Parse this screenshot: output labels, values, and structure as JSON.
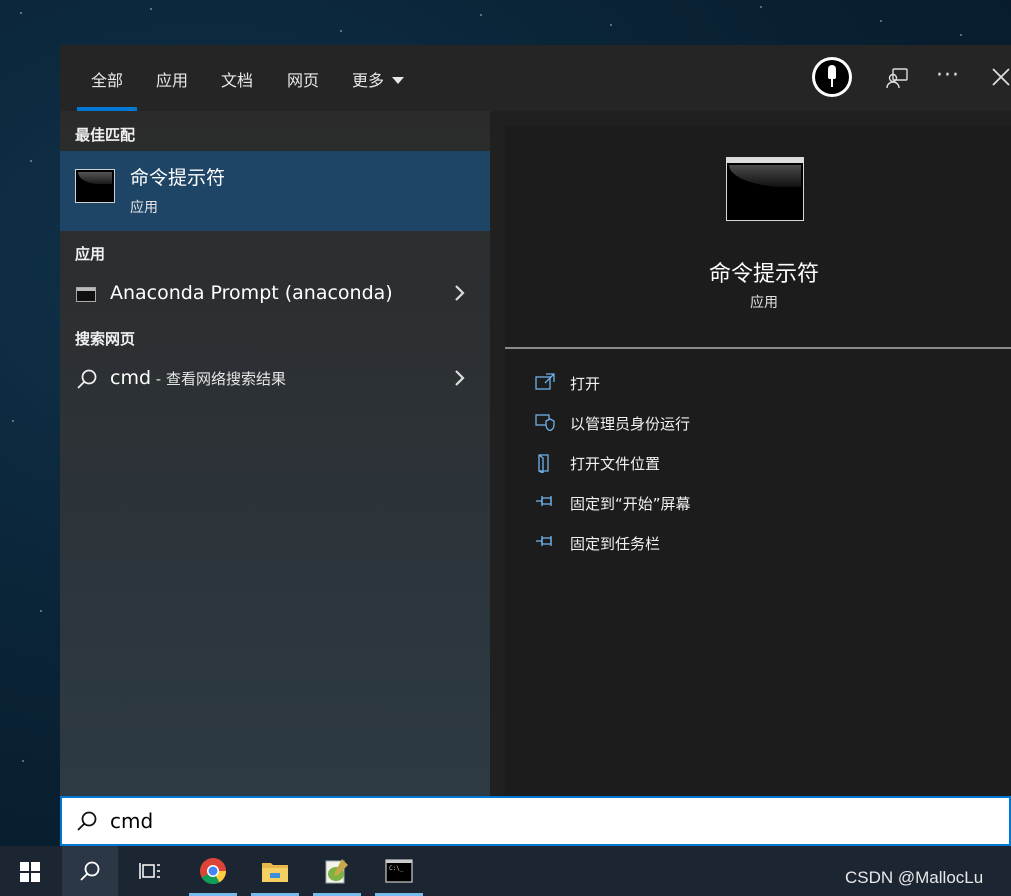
{
  "tabs": [
    {
      "label": "全部",
      "active": true
    },
    {
      "label": "应用"
    },
    {
      "label": "文档"
    },
    {
      "label": "网页"
    },
    {
      "label": "更多"
    }
  ],
  "header_icons": [
    "avatar",
    "feedback-icon",
    "more-options-icon",
    "close-icon"
  ],
  "left": {
    "best_match_title": "最佳匹配",
    "best_match": {
      "name": "命令提示符",
      "type": "应用",
      "icon": "command-prompt-icon"
    },
    "apps_title": "应用",
    "apps": [
      {
        "name": "Anaconda Prompt (anaconda)",
        "icon": "console-icon"
      }
    ],
    "web_title": "搜索网页",
    "web": [
      {
        "query": "cmd",
        "suffix": " - 查看网络搜索结果",
        "icon": "search-icon"
      }
    ]
  },
  "preview": {
    "name": "命令提示符",
    "type": "应用",
    "actions": [
      {
        "label": "打开",
        "icon": "open-icon"
      },
      {
        "label": "以管理员身份运行",
        "icon": "shield-icon"
      },
      {
        "label": "打开文件位置",
        "icon": "file-location-icon"
      },
      {
        "label": "固定到“开始”屏幕",
        "icon": "pin-icon"
      },
      {
        "label": "固定到任务栏",
        "icon": "pin-icon"
      }
    ]
  },
  "search": {
    "value": "cmd"
  },
  "taskbar": {
    "items": [
      "windows-start-icon",
      "search-icon",
      "task-view-icon",
      "chrome-icon",
      "file-explorer-icon",
      "notepad-plus-plus-icon",
      "command-prompt-icon"
    ]
  },
  "watermark": "CSDN @MallocLu",
  "colors": {
    "accent": "#0078d4",
    "selected_item": "#1f4566",
    "panel": "#202020",
    "taskbar": "#1c2633"
  }
}
